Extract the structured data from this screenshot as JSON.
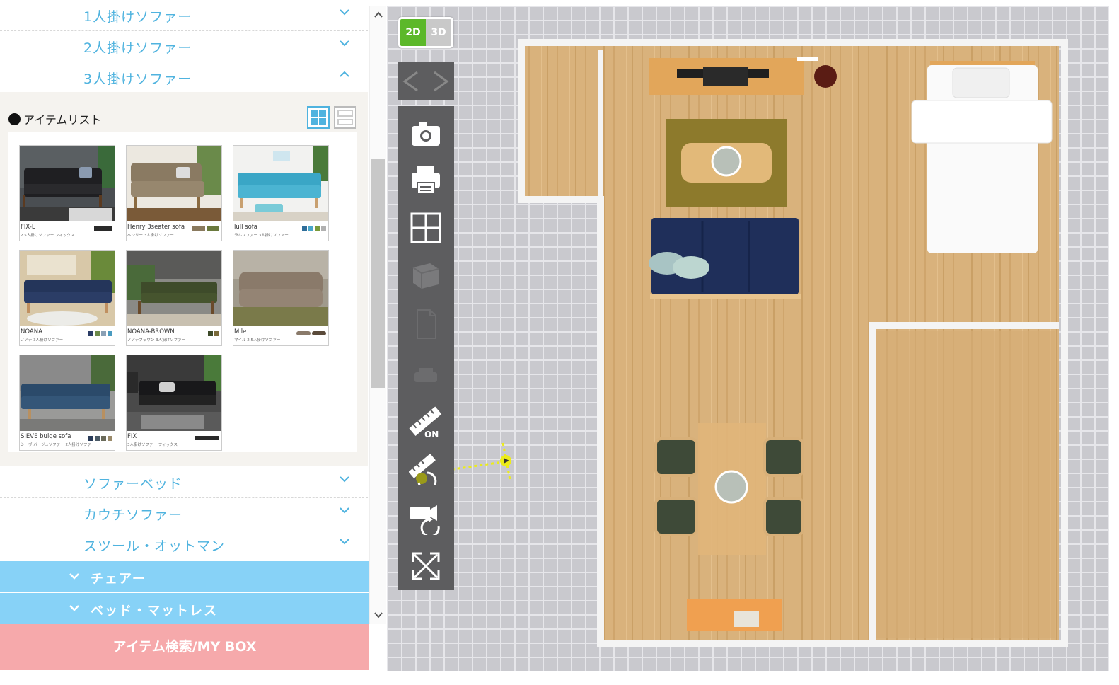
{
  "categories_top": [
    {
      "label": "1人掛けソファー",
      "expanded": false
    },
    {
      "label": "2人掛けソファー",
      "expanded": false
    },
    {
      "label": "3人掛けソファー",
      "expanded": true
    }
  ],
  "item_list": {
    "title": "アイテムリスト",
    "items": [
      {
        "name": "FIX-L",
        "sub": "2.5人掛けソファー フィックス",
        "swatches": [
          "#2a2a2a"
        ]
      },
      {
        "name": "Henry 3seater sofa",
        "sub": "ヘンリー 3人掛けソファー",
        "swatches": [
          "#8a7a5e",
          "#6b7a3e"
        ]
      },
      {
        "name": "lull sofa",
        "sub": "ラルソファー 3人掛けソファー",
        "swatches": [
          "#2f6e9a",
          "#4aa6c8",
          "#7a9a3a",
          "#b0b0b0"
        ]
      },
      {
        "name": "NOANA",
        "sub": "ノアナ 3人掛けソファー",
        "swatches": [
          "#2b3d66",
          "#6c8a4a",
          "#8aa0b5",
          "#4a9bc0"
        ]
      },
      {
        "name": "NOANA-BROWN",
        "sub": "ノアナブラウン 3人掛けソファー",
        "swatches": [
          "#3e4b2a",
          "#7a6a3a"
        ]
      },
      {
        "name": "Mile",
        "sub": "マイル 2.5人掛けソファー",
        "swatches": [
          "#8a7a6a"
        ]
      },
      {
        "name": "SIEVE bulge sofa",
        "sub": "シーヴ バージュソファー 2人掛けソファー",
        "swatches": [
          "#2b3d5a",
          "#4a5a66",
          "#6a6a5a",
          "#9a8a6a"
        ]
      },
      {
        "name": "FIX",
        "sub": "3人掛けソファー フィックス",
        "swatches": [
          "#2a2a2a"
        ]
      }
    ]
  },
  "categories_bottom": [
    {
      "label": "ソファーベッド"
    },
    {
      "label": "カウチソファー"
    },
    {
      "label": "スツール・オットマン"
    }
  ],
  "sections": [
    {
      "label": "チェアー"
    },
    {
      "label": "ベッド・マットレス"
    }
  ],
  "search_button": "アイテム検索/MY BOX",
  "view_toggle": {
    "label_2d": "2D",
    "label_3d": "3D",
    "active": "2D"
  },
  "tools": [
    {
      "icon": "camera-icon",
      "enabled": true
    },
    {
      "icon": "print-icon",
      "enabled": true
    },
    {
      "icon": "layout-grid-icon",
      "enabled": true
    },
    {
      "icon": "cube-3d-icon",
      "enabled": false
    },
    {
      "icon": "document-icon",
      "enabled": false
    },
    {
      "icon": "print-disabled-icon",
      "enabled": false
    },
    {
      "icon": "ruler-on-icon",
      "enabled": true,
      "badge": "ON"
    },
    {
      "icon": "ruler-rotate-icon",
      "enabled": true
    },
    {
      "icon": "camera-rotate-icon",
      "enabled": true
    },
    {
      "icon": "fullscreen-icon",
      "enabled": true
    }
  ],
  "colors": {
    "accent": "#4fb3df",
    "section_bg": "#87d2f7",
    "search_bg": "#f6a9ab",
    "toggle_active": "#5cb82a"
  }
}
